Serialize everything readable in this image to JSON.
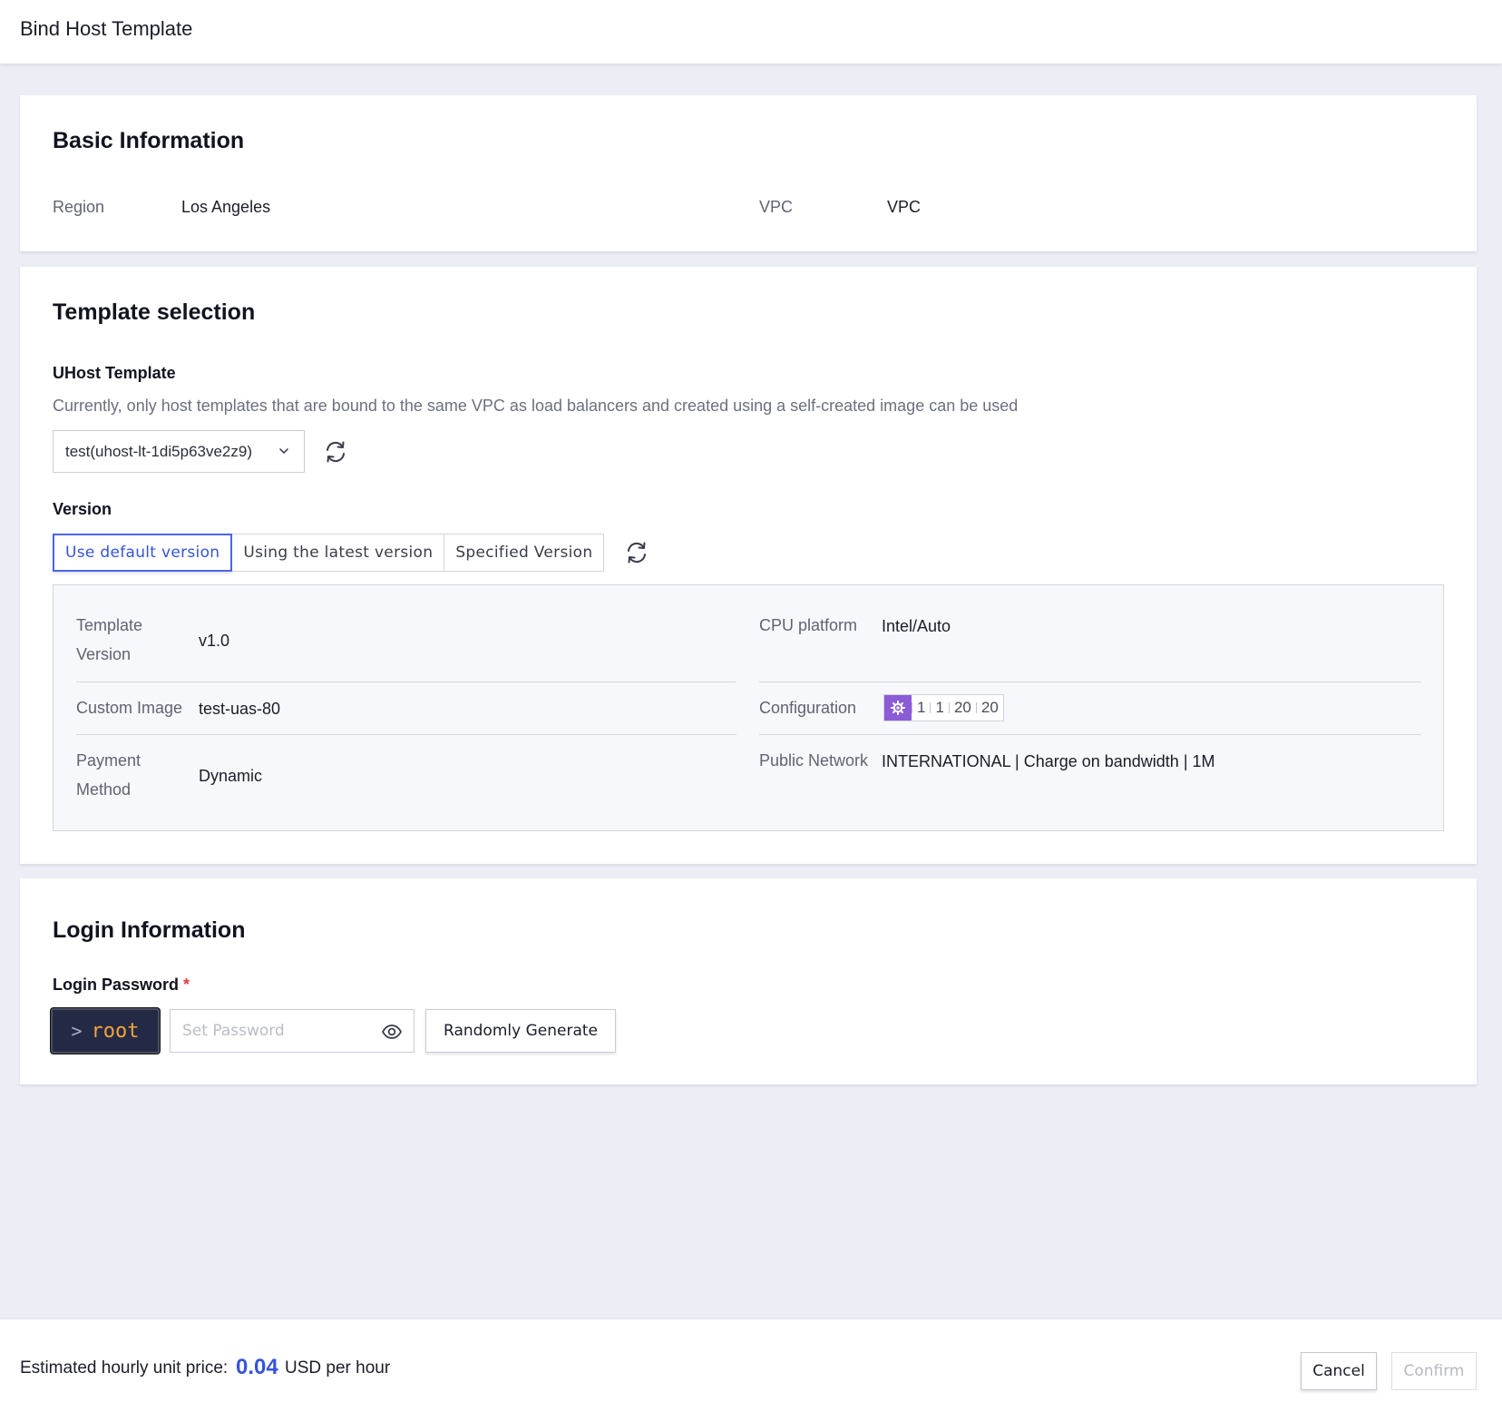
{
  "header": {
    "title": "Bind Host Template"
  },
  "basic_info": {
    "title": "Basic Information",
    "region_label": "Region",
    "region_value": "Los Angeles",
    "vpc_label": "VPC",
    "vpc_value": "VPC"
  },
  "template_selection": {
    "title": "Template selection",
    "uhost_label": "UHost Template",
    "uhost_hint": "Currently, only host templates that are bound to the same VPC as load balancers and created using a self-created image can be used",
    "uhost_selected": "test(uhost-lt-1di5p63ve2z9)",
    "version_label": "Version",
    "version_options": [
      {
        "label": "Use default version",
        "active": true
      },
      {
        "label": "Using the latest version",
        "active": false
      },
      {
        "label": "Specified Version",
        "active": false
      }
    ],
    "details": {
      "template_version_label_line1": "Template",
      "template_version_label_line2": "Version",
      "template_version_value": "v1.0",
      "cpu_platform_label": "CPU platform",
      "cpu_platform_value": "Intel/Auto",
      "custom_image_label": "Custom Image",
      "custom_image_value": "test-uas-80",
      "configuration_label": "Configuration",
      "configuration_values": [
        "1",
        "1",
        "20",
        "20"
      ],
      "payment_label_line1": "Payment",
      "payment_label_line2": "Method",
      "payment_value": "Dynamic",
      "public_network_label": "Public Network",
      "public_network_value": "INTERNATIONAL | Charge on bandwidth | 1M"
    }
  },
  "login_info": {
    "title": "Login Information",
    "password_label": "Login Password",
    "required_mark": "*",
    "user_prompt": ">",
    "user_name": "root",
    "password_placeholder": "Set Password",
    "password_value": "",
    "random_button": "Randomly Generate"
  },
  "footer": {
    "price_label": "Estimated hourly unit price:",
    "price_value": "0.04",
    "price_unit": "USD per hour",
    "cancel_button": "Cancel",
    "confirm_button": "Confirm"
  },
  "colors": {
    "accent": "#3654d9",
    "background": "#edeef5",
    "config_chip": "#8b5cd6",
    "user_badge_bg": "#242a45",
    "user_badge_text": "#f2a43a",
    "required": "#e23c3c"
  },
  "icons": {
    "refresh": "refresh-icon",
    "dropdown": "chevron-down-icon",
    "eye": "eye-icon",
    "cpu_chip": "gear-icon"
  }
}
